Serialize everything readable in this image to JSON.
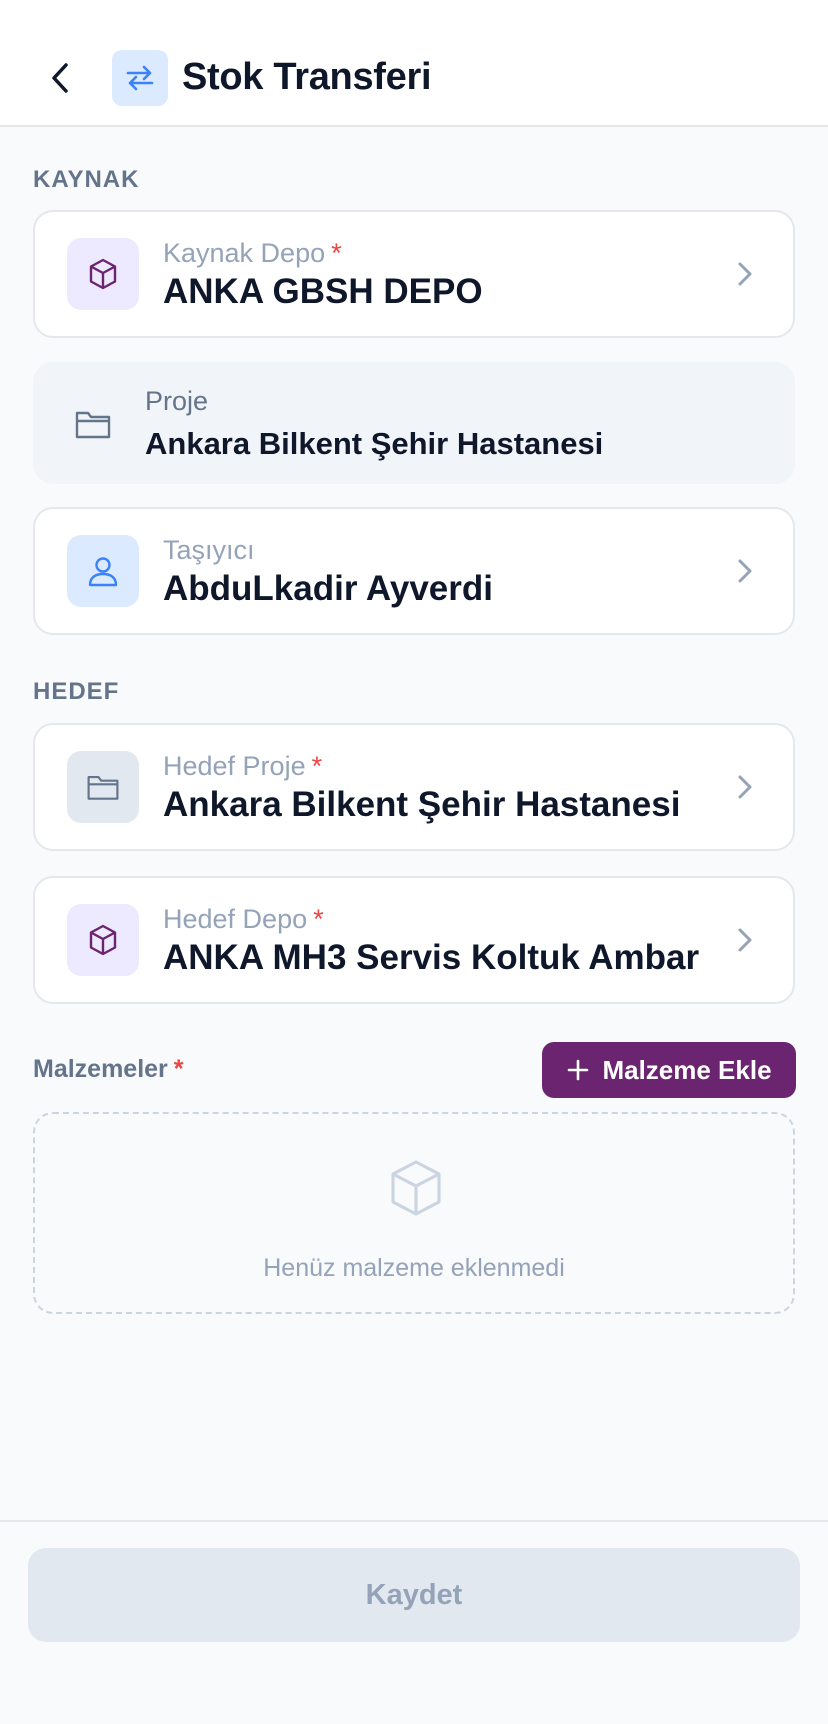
{
  "header": {
    "title": "Stok Transferi",
    "back_icon": "chevron-left-icon",
    "title_icon": "transfer-arrows-icon"
  },
  "source_section": {
    "label": "KAYNAK",
    "source_depot": {
      "label": "Kaynak Depo",
      "required_mark": "*",
      "value": "ANKA GBSH DEPO",
      "icon": "cube-icon"
    },
    "project": {
      "label": "Proje",
      "value": "Ankara Bilkent Şehir Hastanesi",
      "icon": "folder-icon"
    },
    "carrier": {
      "label": "Taşıyıcı",
      "value": "AbduLkadir Ayverdi",
      "icon": "user-icon"
    }
  },
  "target_section": {
    "label": "HEDEF",
    "target_project": {
      "label": "Hedef Proje",
      "required_mark": "*",
      "value": "Ankara Bilkent Şehir Hastanesi",
      "icon": "folder-icon"
    },
    "target_depot": {
      "label": "Hedef Depo",
      "required_mark": "*",
      "value": "ANKA MH3 Servis Koltuk Ambar",
      "icon": "cube-icon"
    }
  },
  "materials": {
    "label": "Malzemeler",
    "required_mark": "*",
    "add_button_label": "Malzeme Ekle",
    "empty_text": "Henüz malzeme eklenmedi"
  },
  "footer": {
    "save_label": "Kaydet"
  },
  "colors": {
    "accent": "#6b2470",
    "required": "#ef4444",
    "blue": "#3b82f6"
  }
}
